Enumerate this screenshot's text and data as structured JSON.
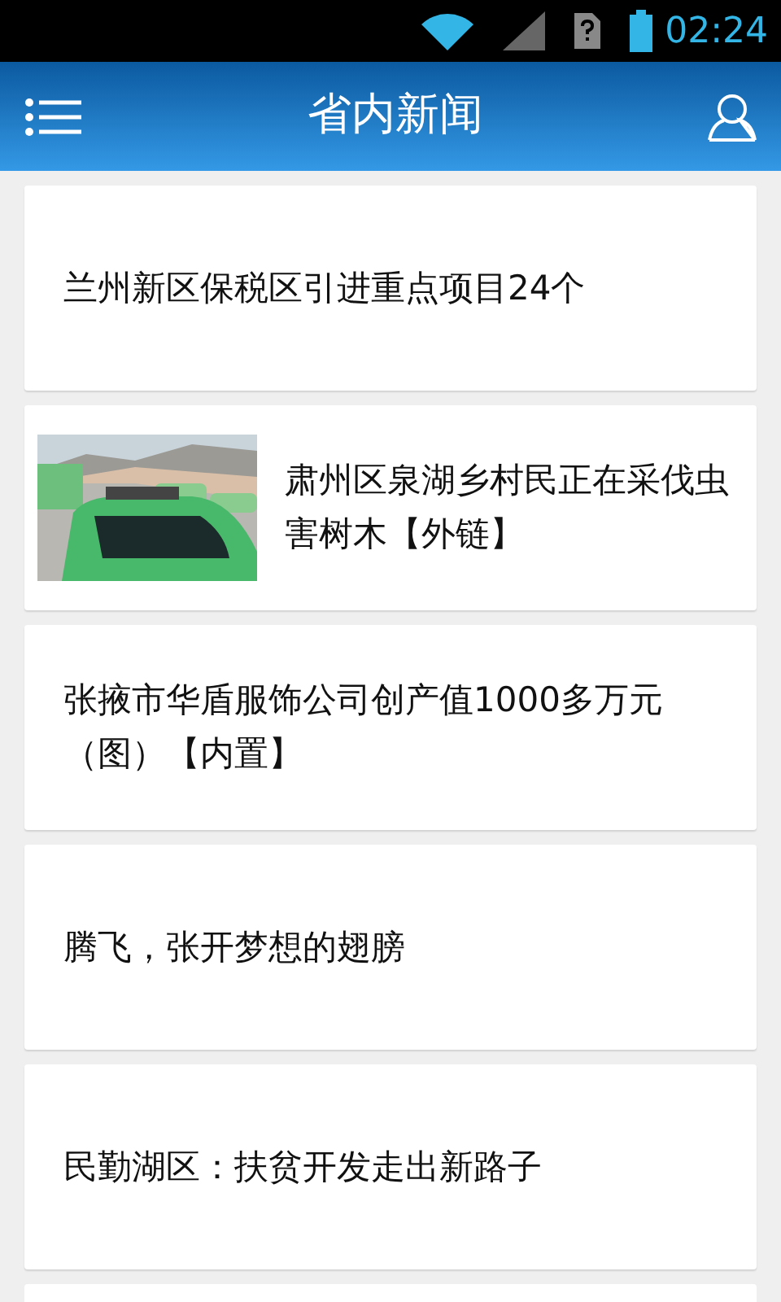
{
  "status_bar": {
    "time": "02:24"
  },
  "header": {
    "title": "省内新闻"
  },
  "news": [
    {
      "kind": "text",
      "title": "兰州新区保税区引进重点项目24个"
    },
    {
      "title": "肃州区泉湖乡村民正在采伐虫害树木【外链】"
    },
    {
      "kind": "text",
      "title": "张掖市华盾服饰公司创产值1000多万元（图）【内置】"
    },
    {
      "kind": "text",
      "title": "腾飞，张开梦想的翅膀"
    },
    {
      "kind": "text",
      "title": "民勤湖区：扶贫开发走出新路子"
    }
  ]
}
